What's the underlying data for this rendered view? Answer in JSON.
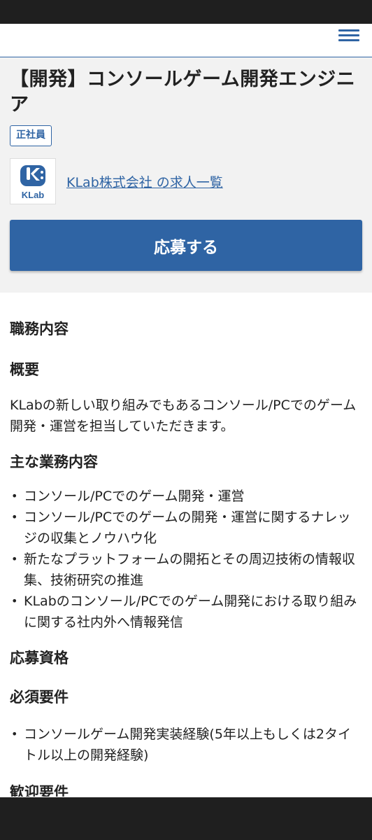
{
  "nav": {
    "menu_icon": "hamburger-menu-icon"
  },
  "job": {
    "title": "【開発】コンソールゲーム開発エンジニア",
    "employment_type": "正社員",
    "company_logo_text": "KLab",
    "company_link": "KLab株式会社 の求人一覧",
    "apply_label": "応募する"
  },
  "content": {
    "duties_heading": "職務内容",
    "overview_heading": "概要",
    "overview_text": "KLabの新しい取り組みでもあるコンソール/PCでのゲーム開発・運営を担当していただきます。",
    "main_duties_heading": "主な業務内容",
    "main_duties": [
      "コンソール/PCでのゲーム開発・運営",
      "コンソール/PCでのゲームの開発・運営に関するナレッジの収集とノウハウ化",
      "新たなプラットフォームの開拓とその周辺技術の情報収集、技術研究の推進",
      "KLabのコンソール/PCでのゲーム開発における取り組みに関する社内外へ情報発信"
    ],
    "requirements_heading": "応募資格",
    "required_heading": "必須要件",
    "required_items": [
      "コンソールゲーム開発実装経験(5年以上もしくは2タイトル以上の開発経験)"
    ],
    "welcome_heading": "歓迎要件"
  },
  "colors": {
    "accent": "#2f64a4",
    "header_bg": "#f2f2f2",
    "system_bar": "#1f1f1f"
  }
}
